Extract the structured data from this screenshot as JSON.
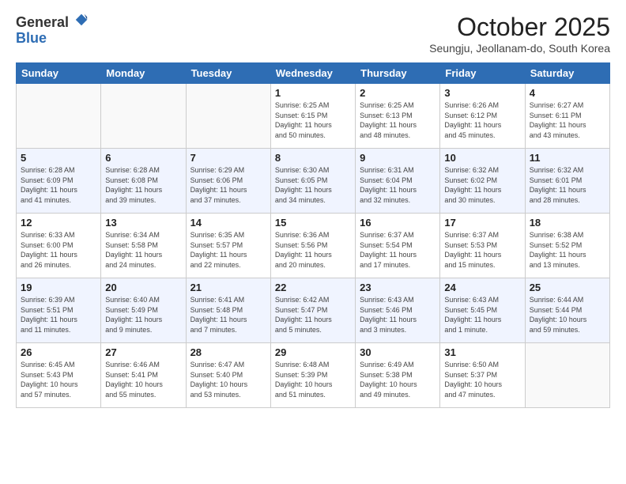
{
  "header": {
    "logo_line1": "General",
    "logo_line2": "Blue",
    "month_title": "October 2025",
    "subtitle": "Seungju, Jeollanam-do, South Korea"
  },
  "days_of_week": [
    "Sunday",
    "Monday",
    "Tuesday",
    "Wednesday",
    "Thursday",
    "Friday",
    "Saturday"
  ],
  "weeks": [
    [
      {
        "num": "",
        "info": ""
      },
      {
        "num": "",
        "info": ""
      },
      {
        "num": "",
        "info": ""
      },
      {
        "num": "1",
        "info": "Sunrise: 6:25 AM\nSunset: 6:15 PM\nDaylight: 11 hours\nand 50 minutes."
      },
      {
        "num": "2",
        "info": "Sunrise: 6:25 AM\nSunset: 6:13 PM\nDaylight: 11 hours\nand 48 minutes."
      },
      {
        "num": "3",
        "info": "Sunrise: 6:26 AM\nSunset: 6:12 PM\nDaylight: 11 hours\nand 45 minutes."
      },
      {
        "num": "4",
        "info": "Sunrise: 6:27 AM\nSunset: 6:11 PM\nDaylight: 11 hours\nand 43 minutes."
      }
    ],
    [
      {
        "num": "5",
        "info": "Sunrise: 6:28 AM\nSunset: 6:09 PM\nDaylight: 11 hours\nand 41 minutes."
      },
      {
        "num": "6",
        "info": "Sunrise: 6:28 AM\nSunset: 6:08 PM\nDaylight: 11 hours\nand 39 minutes."
      },
      {
        "num": "7",
        "info": "Sunrise: 6:29 AM\nSunset: 6:06 PM\nDaylight: 11 hours\nand 37 minutes."
      },
      {
        "num": "8",
        "info": "Sunrise: 6:30 AM\nSunset: 6:05 PM\nDaylight: 11 hours\nand 34 minutes."
      },
      {
        "num": "9",
        "info": "Sunrise: 6:31 AM\nSunset: 6:04 PM\nDaylight: 11 hours\nand 32 minutes."
      },
      {
        "num": "10",
        "info": "Sunrise: 6:32 AM\nSunset: 6:02 PM\nDaylight: 11 hours\nand 30 minutes."
      },
      {
        "num": "11",
        "info": "Sunrise: 6:32 AM\nSunset: 6:01 PM\nDaylight: 11 hours\nand 28 minutes."
      }
    ],
    [
      {
        "num": "12",
        "info": "Sunrise: 6:33 AM\nSunset: 6:00 PM\nDaylight: 11 hours\nand 26 minutes."
      },
      {
        "num": "13",
        "info": "Sunrise: 6:34 AM\nSunset: 5:58 PM\nDaylight: 11 hours\nand 24 minutes."
      },
      {
        "num": "14",
        "info": "Sunrise: 6:35 AM\nSunset: 5:57 PM\nDaylight: 11 hours\nand 22 minutes."
      },
      {
        "num": "15",
        "info": "Sunrise: 6:36 AM\nSunset: 5:56 PM\nDaylight: 11 hours\nand 20 minutes."
      },
      {
        "num": "16",
        "info": "Sunrise: 6:37 AM\nSunset: 5:54 PM\nDaylight: 11 hours\nand 17 minutes."
      },
      {
        "num": "17",
        "info": "Sunrise: 6:37 AM\nSunset: 5:53 PM\nDaylight: 11 hours\nand 15 minutes."
      },
      {
        "num": "18",
        "info": "Sunrise: 6:38 AM\nSunset: 5:52 PM\nDaylight: 11 hours\nand 13 minutes."
      }
    ],
    [
      {
        "num": "19",
        "info": "Sunrise: 6:39 AM\nSunset: 5:51 PM\nDaylight: 11 hours\nand 11 minutes."
      },
      {
        "num": "20",
        "info": "Sunrise: 6:40 AM\nSunset: 5:49 PM\nDaylight: 11 hours\nand 9 minutes."
      },
      {
        "num": "21",
        "info": "Sunrise: 6:41 AM\nSunset: 5:48 PM\nDaylight: 11 hours\nand 7 minutes."
      },
      {
        "num": "22",
        "info": "Sunrise: 6:42 AM\nSunset: 5:47 PM\nDaylight: 11 hours\nand 5 minutes."
      },
      {
        "num": "23",
        "info": "Sunrise: 6:43 AM\nSunset: 5:46 PM\nDaylight: 11 hours\nand 3 minutes."
      },
      {
        "num": "24",
        "info": "Sunrise: 6:43 AM\nSunset: 5:45 PM\nDaylight: 11 hours\nand 1 minute."
      },
      {
        "num": "25",
        "info": "Sunrise: 6:44 AM\nSunset: 5:44 PM\nDaylight: 10 hours\nand 59 minutes."
      }
    ],
    [
      {
        "num": "26",
        "info": "Sunrise: 6:45 AM\nSunset: 5:43 PM\nDaylight: 10 hours\nand 57 minutes."
      },
      {
        "num": "27",
        "info": "Sunrise: 6:46 AM\nSunset: 5:41 PM\nDaylight: 10 hours\nand 55 minutes."
      },
      {
        "num": "28",
        "info": "Sunrise: 6:47 AM\nSunset: 5:40 PM\nDaylight: 10 hours\nand 53 minutes."
      },
      {
        "num": "29",
        "info": "Sunrise: 6:48 AM\nSunset: 5:39 PM\nDaylight: 10 hours\nand 51 minutes."
      },
      {
        "num": "30",
        "info": "Sunrise: 6:49 AM\nSunset: 5:38 PM\nDaylight: 10 hours\nand 49 minutes."
      },
      {
        "num": "31",
        "info": "Sunrise: 6:50 AM\nSunset: 5:37 PM\nDaylight: 10 hours\nand 47 minutes."
      },
      {
        "num": "",
        "info": ""
      }
    ]
  ]
}
